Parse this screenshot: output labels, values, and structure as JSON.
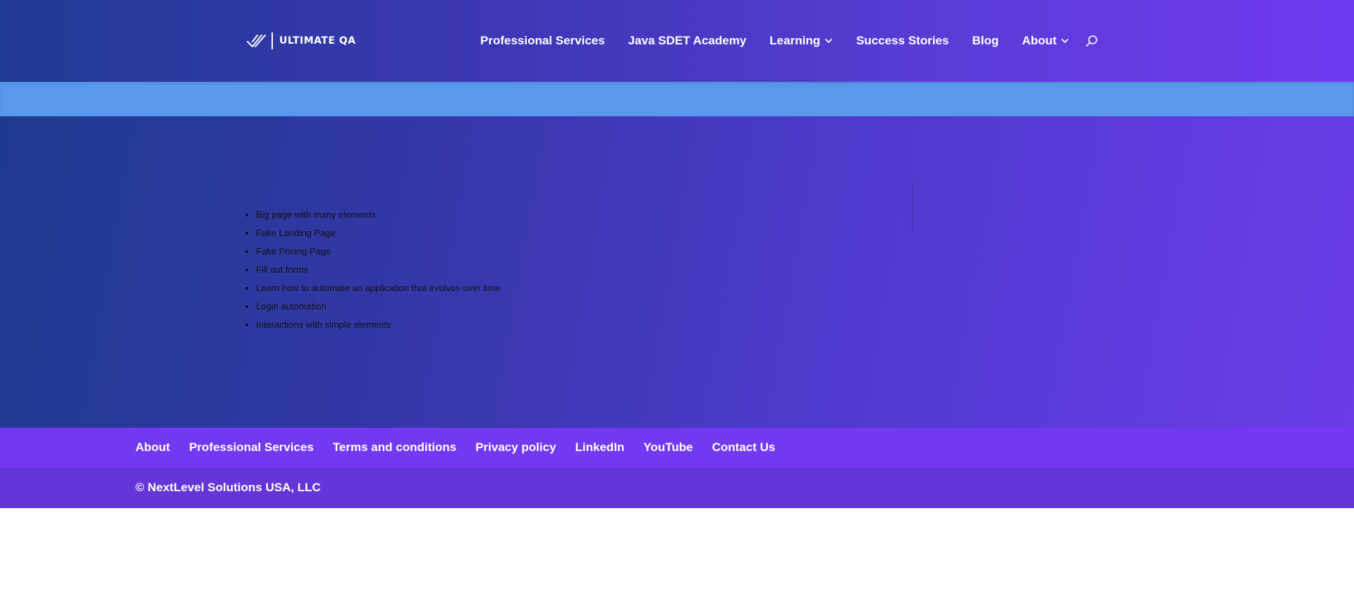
{
  "header": {
    "logo_text": "ULTIMATE QA",
    "logo_icon": "checkmark-logo-icon",
    "nav": [
      {
        "label": "Professional Services",
        "has_dropdown": false
      },
      {
        "label": "Java SDET Academy",
        "has_dropdown": false
      },
      {
        "label": "Learning",
        "has_dropdown": true
      },
      {
        "label": "Success Stories",
        "has_dropdown": false
      },
      {
        "label": "Blog",
        "has_dropdown": false
      },
      {
        "label": "About",
        "has_dropdown": true
      }
    ],
    "search_icon": "search-icon"
  },
  "main": {
    "links": [
      "Big page with many elements",
      "Fake Landing Page",
      "Fake Pricing Page",
      "Fill out forms",
      "Learn how to automate an application that evolves over time",
      "Login automation",
      "Interactions with simple elements"
    ]
  },
  "footer": {
    "links": [
      "About",
      "Professional Services",
      "Terms and conditions",
      "Privacy policy",
      "LinkedIn",
      "YouTube",
      "Contact Us"
    ],
    "copyright": "© NextLevel Solutions USA, LLC"
  },
  "colors": {
    "header_gradient_start": "#1f3a93",
    "header_gradient_end": "#7139f1",
    "blue_band": "#5899ee",
    "footer_nav": "#7239f1",
    "copyright_bar": "#6436d8"
  }
}
